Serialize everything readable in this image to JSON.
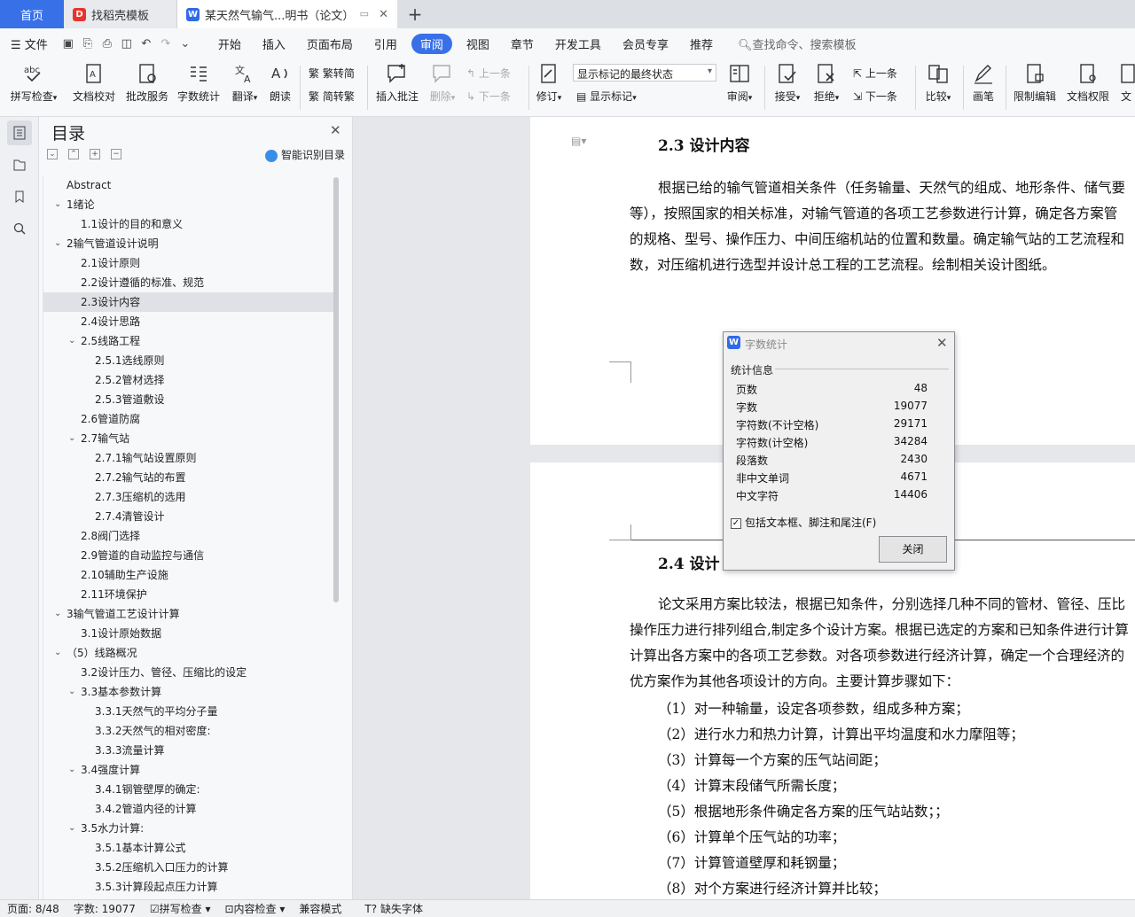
{
  "tabs": [
    {
      "label": "首页"
    },
    {
      "label": "找稻壳模板"
    },
    {
      "label": "某天然气输气...明书（论文）"
    }
  ],
  "menu": {
    "file": "文件",
    "items": [
      "开始",
      "插入",
      "页面布局",
      "引用",
      "审阅",
      "视图",
      "章节",
      "开发工具",
      "会员专享",
      "推荐"
    ],
    "active": "审阅",
    "search": "查找命令、搜索模板"
  },
  "ribbon": {
    "spell": "拼写检查",
    "proof": "文档校对",
    "annot_svc": "批改服务",
    "wordcount": "字数统计",
    "translate": "翻译",
    "read": "朗读",
    "trad": "繁转简",
    "simp": "简转繁",
    "insert_comment": "插入批注",
    "delete": "删除",
    "prev": "上一条",
    "next": "下一条",
    "revise": "修订",
    "markup_select": "显示标记的最终状态",
    "show_markup": "显示标记",
    "review": "审阅",
    "accept": "接受",
    "reject": "拒绝",
    "prev2": "上一条",
    "next2": "下一条",
    "compare": "比较",
    "pen": "画笔",
    "restrict": "限制编辑",
    "doc_perm": "文档权限",
    "doc_more": "文"
  },
  "toc": {
    "title": "目录",
    "smart": "智能识别目录",
    "items": [
      {
        "label": "Abstract",
        "level": 0,
        "arrow": false
      },
      {
        "label": "1绪论",
        "level": 0,
        "arrow": true
      },
      {
        "label": "1.1设计的目的和意义",
        "level": 1,
        "arrow": false
      },
      {
        "label": "2输气管道设计说明",
        "level": 0,
        "arrow": true
      },
      {
        "label": "2.1设计原则",
        "level": 1,
        "arrow": false
      },
      {
        "label": "2.2设计遵循的标准、规范",
        "level": 1,
        "arrow": false
      },
      {
        "label": "2.3设计内容",
        "level": 1,
        "arrow": false,
        "selected": true
      },
      {
        "label": "2.4设计思路",
        "level": 1,
        "arrow": false
      },
      {
        "label": "2.5线路工程",
        "level": 1,
        "arrow": true
      },
      {
        "label": "2.5.1选线原则",
        "level": 2,
        "arrow": false
      },
      {
        "label": "2.5.2管材选择",
        "level": 2,
        "arrow": false
      },
      {
        "label": "2.5.3管道敷设",
        "level": 2,
        "arrow": false
      },
      {
        "label": "2.6管道防腐",
        "level": 1,
        "arrow": false
      },
      {
        "label": "2.7输气站",
        "level": 1,
        "arrow": true
      },
      {
        "label": "2.7.1输气站设置原则",
        "level": 2,
        "arrow": false
      },
      {
        "label": "2.7.2输气站的布置",
        "level": 2,
        "arrow": false
      },
      {
        "label": "2.7.3压缩机的选用",
        "level": 2,
        "arrow": false
      },
      {
        "label": "2.7.4清管设计",
        "level": 2,
        "arrow": false
      },
      {
        "label": "2.8阀门选择",
        "level": 1,
        "arrow": false
      },
      {
        "label": "2.9管道的自动监控与通信",
        "level": 1,
        "arrow": false
      },
      {
        "label": "2.10辅助生产设施",
        "level": 1,
        "arrow": false
      },
      {
        "label": "2.11环境保护",
        "level": 1,
        "arrow": false
      },
      {
        "label": "3输气管道工艺设计计算",
        "level": 0,
        "arrow": true
      },
      {
        "label": "3.1设计原始数据",
        "level": 1,
        "arrow": false
      },
      {
        "label": "（5）线路概况",
        "level": 0,
        "arrow": true
      },
      {
        "label": "3.2设计压力、管径、压缩比的设定",
        "level": 1,
        "arrow": false
      },
      {
        "label": "3.3基本参数计算",
        "level": 1,
        "arrow": true
      },
      {
        "label": "3.3.1天然气的平均分子量",
        "level": 2,
        "arrow": false
      },
      {
        "label": "3.3.2天然气的相对密度:",
        "level": 2,
        "arrow": false
      },
      {
        "label": "3.3.3流量计算",
        "level": 2,
        "arrow": false
      },
      {
        "label": "3.4强度计算",
        "level": 1,
        "arrow": true
      },
      {
        "label": "3.4.1钢管壁厚的确定:",
        "level": 2,
        "arrow": false
      },
      {
        "label": "3.4.2管道内径的计算",
        "level": 2,
        "arrow": false
      },
      {
        "label": "3.5水力计算:",
        "level": 1,
        "arrow": true
      },
      {
        "label": "3.5.1基本计算公式",
        "level": 2,
        "arrow": false
      },
      {
        "label": "3.5.2压缩机入口压力的计算",
        "level": 2,
        "arrow": false
      },
      {
        "label": "3.5.3计算段起点压力计算",
        "level": 2,
        "arrow": false
      }
    ]
  },
  "doc": {
    "h23": "2.3 设计内容",
    "p23": [
      "根据已给的输气管道相关条件（任务输量、天然气的组成、地形条件、储气要",
      "等），按照国家的相关标准，对输气管道的各项工艺参数进行计算，确定各方案管",
      "的规格、型号、操作压力、中间压缩机站的位置和数量。确定输气站的工艺流程和",
      "数，对压缩机进行选型并设计总工程的工艺流程。绘制相关设计图纸。"
    ],
    "h24": "2.4 设计",
    "p24": [
      "论文采用方案比较法，根据已知条件，分别选择几种不同的管材、管径、压比",
      "操作压力进行排列组合,制定多个设计方案。根据已选定的方案和已知条件进行计算",
      "计算出各方案中的各项工艺参数。对各项参数进行经济计算，确定一个合理经济的",
      "优方案作为其他各项设计的方向。主要计算步骤如下："
    ],
    "steps": [
      "（1）对一种输量，设定各项参数，组成多种方案；",
      "（2）进行水力和热力计算，计算出平均温度和水力摩阻等；",
      "（3）计算每一个方案的压气站间距；",
      "（4）计算末段储气所需长度；",
      "（5）根据地形条件确定各方案的压气站站数；；",
      "（6）计算单个压气站的功率；",
      "（7）计算管道壁厚和耗钢量；",
      "（8）对个方案进行经济计算并比较；"
    ]
  },
  "dialog": {
    "title": "字数统计",
    "group": "统计信息",
    "rows": [
      {
        "label": "页数",
        "value": "48"
      },
      {
        "label": "字数",
        "value": "19077"
      },
      {
        "label": "字符数(不计空格)",
        "value": "29171"
      },
      {
        "label": "字符数(计空格)",
        "value": "34284"
      },
      {
        "label": "段落数",
        "value": "2430"
      },
      {
        "label": "非中文单词",
        "value": "4671"
      },
      {
        "label": "中文字符",
        "value": "14406"
      }
    ],
    "checkbox": "包括文本框、脚注和尾注(F)",
    "close": "关闭"
  },
  "status": {
    "page": "页面: 8/48",
    "words": "字数: 19077",
    "spell": "拼写检查",
    "content": "内容检查",
    "compat": "兼容模式",
    "font": "缺失字体"
  }
}
